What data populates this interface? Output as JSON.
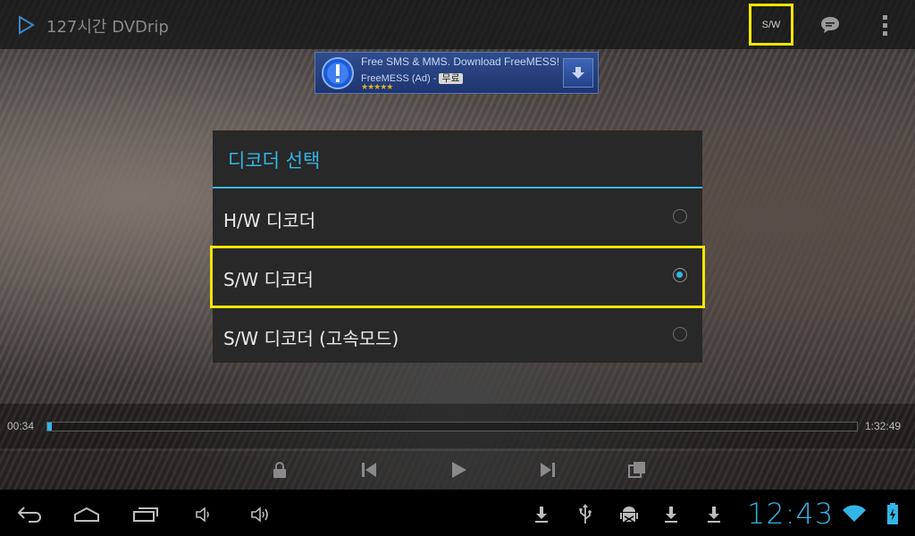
{
  "top_bar": {
    "title": "127시간 DVDrip",
    "decoder_button_label": "S/W"
  },
  "ad": {
    "line1": "Free SMS & MMS. Download FreeMESS!",
    "line2_app": "FreeMESS (Ad) -",
    "line2_price": "무료",
    "stars": "★★★★★"
  },
  "dialog": {
    "title": "디코더 선택",
    "options": [
      {
        "label": "H/W 디코더",
        "selected": false
      },
      {
        "label": "S/W 디코더",
        "selected": true
      },
      {
        "label": "S/W 디코더 (고속모드)",
        "selected": false
      }
    ]
  },
  "player": {
    "current_time": "00:34",
    "total_time": "1:32:49",
    "progress_fraction": 0.006
  },
  "status_bar": {
    "clock": "12:43"
  },
  "colors": {
    "accent": "#33b5e5",
    "highlight": "#f6e600"
  }
}
